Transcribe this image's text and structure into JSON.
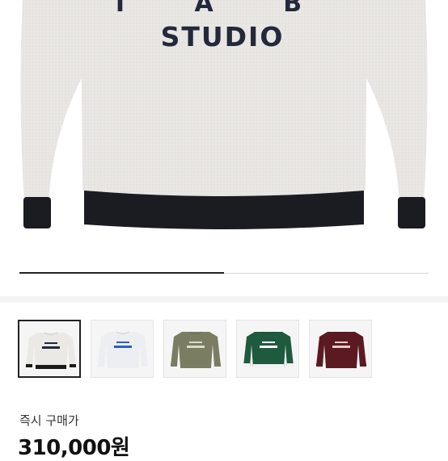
{
  "product": {
    "garment_print_line1": "I A B",
    "garment_print_line2": "STUDIO",
    "gallery_position": 0.5
  },
  "thumbnails": [
    {
      "name": "thumb-oatmeal",
      "body": "#ebe9e6",
      "trim": "#1a1a1a",
      "text": "#23283a",
      "selected": true
    },
    {
      "name": "thumb-white",
      "body": "#eceef1",
      "trim": "#eceef1",
      "text": "#2e5fc0",
      "selected": false
    },
    {
      "name": "thumb-khaki",
      "body": "#7b7d62",
      "trim": "#7b7d62",
      "text": "#d8dcc8",
      "selected": false
    },
    {
      "name": "thumb-green",
      "body": "#1d5a3e",
      "trim": "#f2f2f2",
      "text": "#ffffff",
      "selected": false
    },
    {
      "name": "thumb-burgundy",
      "body": "#5b1a22",
      "trim": "#5b1a22",
      "text": "#e8c9c9",
      "selected": false
    }
  ],
  "purchase": {
    "label": "즉시 구매가",
    "price": "310,000원"
  },
  "colors": {
    "accent": "#222222"
  }
}
